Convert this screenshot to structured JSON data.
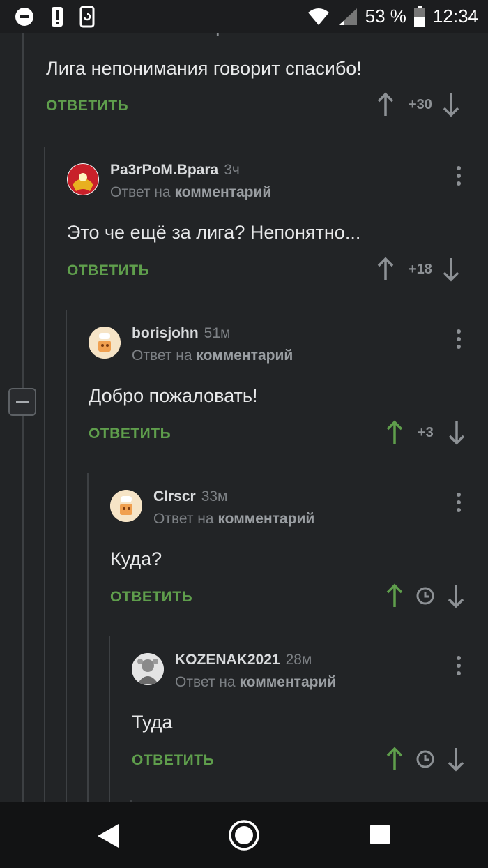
{
  "status_bar": {
    "battery_percent": "53 %",
    "time": "12:34",
    "icons": [
      "do-not-disturb-icon",
      "alert-icon",
      "sync-icon",
      "wifi-icon",
      "signal-icon",
      "battery-icon"
    ]
  },
  "header_fragment": {
    "text": "Ответ на",
    "bold": "комментарий"
  },
  "comments": [
    {
      "text": "Лига непонимания говорит спасибо!",
      "reply_label": "ОТВЕТИТЬ",
      "score": "+30",
      "upvoted": false
    },
    {
      "author": "Pa3rPoM.Bpara",
      "age": "3ч",
      "reply_to": "Ответ на",
      "reply_to_bold": "комментарий",
      "text": "Это че ещё за лига? Непонятно...",
      "reply_label": "ОТВЕТИТЬ",
      "score": "+18",
      "upvoted": false
    },
    {
      "author": "borisjohn",
      "age": "51м",
      "reply_to": "Ответ на",
      "reply_to_bold": "комментарий",
      "text": "Добро пожаловать!",
      "reply_label": "ОТВЕТИТЬ",
      "score": "+3",
      "upvoted": true
    },
    {
      "author": "Clrscr",
      "age": "33м",
      "reply_to": "Ответ на",
      "reply_to_bold": "комментарий",
      "text": "Куда?",
      "reply_label": "ОТВЕТИТЬ",
      "score_icon": "clock-icon",
      "upvoted": true
    },
    {
      "author": "KOZENAK2021",
      "age": "28м",
      "reply_to": "Ответ на",
      "reply_to_bold": "комментарий",
      "text": "Туда",
      "reply_label": "ОТВЕТИТЬ",
      "score_icon": "clock-icon",
      "upvoted": true
    }
  ],
  "colors": {
    "background": "#222426",
    "accent_green": "#5f9e4c",
    "muted": "#7d8185"
  },
  "nav": {
    "icons": [
      "back-icon",
      "home-icon",
      "recents-icon"
    ]
  }
}
